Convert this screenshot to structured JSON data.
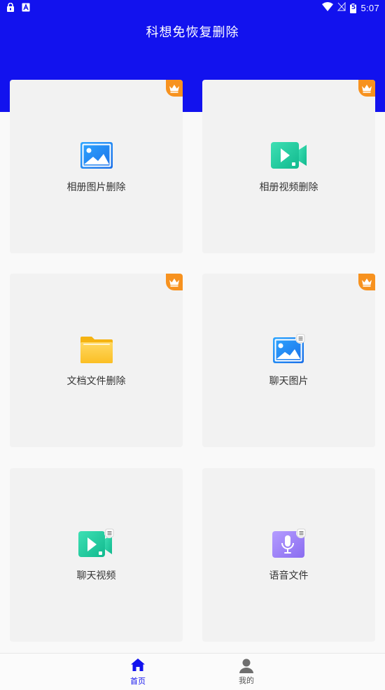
{
  "status_bar": {
    "time": "5:07",
    "battery_level": "5"
  },
  "app": {
    "title": "科想免恢复删除"
  },
  "colors": {
    "primary": "#1212ee",
    "vip": "#f7921f",
    "card_bg": "#f2f2f2"
  },
  "cards": [
    {
      "label": "相册图片删除",
      "icon": "image-icon",
      "vip": true
    },
    {
      "label": "相册视频删除",
      "icon": "video-icon",
      "vip": true
    },
    {
      "label": "文档文件删除",
      "icon": "folder-icon",
      "vip": true
    },
    {
      "label": "聊天图片",
      "icon": "chat-image-icon",
      "vip": true
    },
    {
      "label": "聊天视频",
      "icon": "chat-video-icon",
      "vip": false
    },
    {
      "label": "语音文件",
      "icon": "voice-file-icon",
      "vip": false
    }
  ],
  "bottom_nav": {
    "items": [
      {
        "label": "首页",
        "icon": "home-icon",
        "active": true
      },
      {
        "label": "我的",
        "icon": "profile-icon",
        "active": false
      }
    ]
  }
}
